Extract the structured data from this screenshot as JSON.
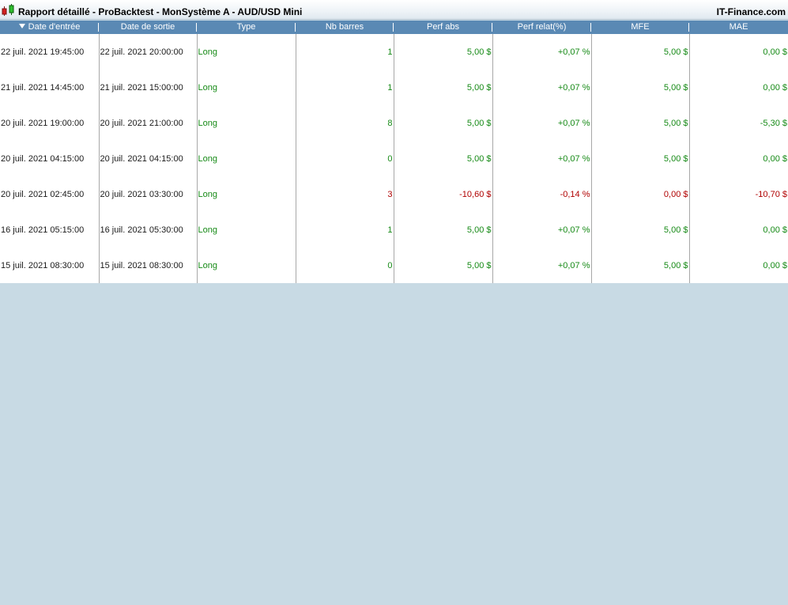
{
  "window": {
    "title": "Rapport détaillé - ProBacktest - MonSystème A - AUD/USD Mini",
    "brand": "IT-Finance.com",
    "icon": "candlestick-chart-icon"
  },
  "colors": {
    "header_bg": "#5a89b4",
    "positive": "#168a16",
    "negative": "#b00000",
    "background": "#c8dae4"
  },
  "table": {
    "sort_icon": "sort-descending-icon",
    "columns": [
      "Date d'entrée",
      "Date de sortie",
      "Type",
      "Nb barres",
      "Perf abs",
      "Perf relat(%)",
      "MFE",
      "MAE"
    ],
    "rows": [
      {
        "entry": "22 juil. 2021 19:45:00",
        "exit": "22 juil. 2021 20:00:00",
        "type": "Long",
        "bars": "1",
        "perf_abs": "5,00 $",
        "perf_rel": "+0,07 %",
        "mfe": "5,00 $",
        "mae": "0,00 $",
        "sign": "pos",
        "bars_sign": "pos",
        "mfe_sign": "pos",
        "mae_sign": "pos"
      },
      {
        "entry": "21 juil. 2021 14:45:00",
        "exit": "21 juil. 2021 15:00:00",
        "type": "Long",
        "bars": "1",
        "perf_abs": "5,00 $",
        "perf_rel": "+0,07 %",
        "mfe": "5,00 $",
        "mae": "0,00 $",
        "sign": "pos",
        "bars_sign": "pos",
        "mfe_sign": "pos",
        "mae_sign": "pos"
      },
      {
        "entry": "20 juil. 2021 19:00:00",
        "exit": "20 juil. 2021 21:00:00",
        "type": "Long",
        "bars": "8",
        "perf_abs": "5,00 $",
        "perf_rel": "+0,07 %",
        "mfe": "5,00 $",
        "mae": "-5,30 $",
        "sign": "pos",
        "bars_sign": "pos",
        "mfe_sign": "pos",
        "mae_sign": "pos"
      },
      {
        "entry": "20 juil. 2021 04:15:00",
        "exit": "20 juil. 2021 04:15:00",
        "type": "Long",
        "bars": "0",
        "perf_abs": "5,00 $",
        "perf_rel": "+0,07 %",
        "mfe": "5,00 $",
        "mae": "0,00 $",
        "sign": "pos",
        "bars_sign": "pos",
        "mfe_sign": "pos",
        "mae_sign": "pos"
      },
      {
        "entry": "20 juil. 2021 02:45:00",
        "exit": "20 juil. 2021 03:30:00",
        "type": "Long",
        "bars": "3",
        "perf_abs": "-10,60 $",
        "perf_rel": "-0,14 %",
        "mfe": "0,00 $",
        "mae": "-10,70 $",
        "sign": "neg",
        "bars_sign": "neg",
        "mfe_sign": "neg",
        "mae_sign": "neg"
      },
      {
        "entry": "16 juil. 2021 05:15:00",
        "exit": "16 juil. 2021 05:30:00",
        "type": "Long",
        "bars": "1",
        "perf_abs": "5,00 $",
        "perf_rel": "+0,07 %",
        "mfe": "5,00 $",
        "mae": "0,00 $",
        "sign": "pos",
        "bars_sign": "pos",
        "mfe_sign": "pos",
        "mae_sign": "pos"
      },
      {
        "entry": "15 juil. 2021 08:30:00",
        "exit": "15 juil. 2021 08:30:00",
        "type": "Long",
        "bars": "0",
        "perf_abs": "5,00 $",
        "perf_rel": "+0,07 %",
        "mfe": "5,00 $",
        "mae": "0,00 $",
        "sign": "pos",
        "bars_sign": "pos",
        "mfe_sign": "pos",
        "mae_sign": "pos"
      }
    ]
  }
}
